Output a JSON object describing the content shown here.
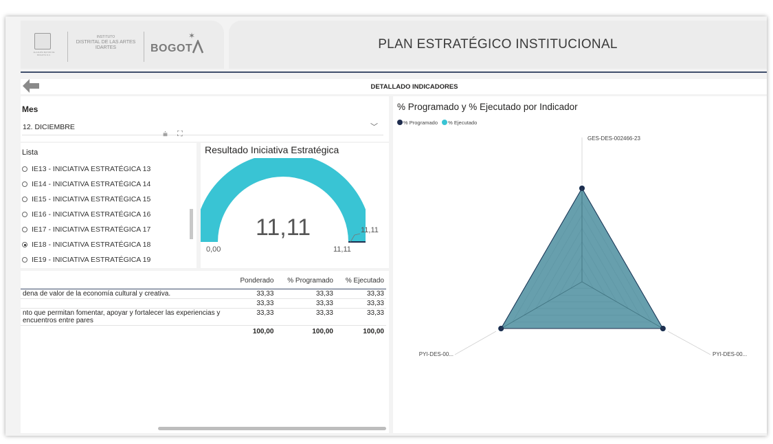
{
  "header": {
    "logo": {
      "institute_small": "INSTITUTO",
      "institute_line1": "DISTRITAL DE LAS ARTES",
      "institute_line2": "IDARTES",
      "city": "BOGOT",
      "crest_caption": "ALCALDÍA MAYOR DE BOGOTÁ D.C."
    },
    "title": "PLAN ESTRATÉGICO INSTITUCIONAL"
  },
  "subheader": {
    "title": "DETALLADO INDICADORES",
    "back_icon": "arrow-left-icon"
  },
  "filters": {
    "mes_label": "Mes",
    "mes_value": "12. DICIEMBRE",
    "lista_label": "Lista",
    "lista_items": [
      {
        "label": "IE13 - INICIATIVA ESTRATÉGICA 13",
        "selected": false
      },
      {
        "label": "IE14 - INICIATIVA ESTRATÉGICA 14",
        "selected": false
      },
      {
        "label": "IE15 - INICIATIVA ESTRATÉGICA 15",
        "selected": false
      },
      {
        "label": "IE16 - INICIATIVA ESTRATÉGICA 16",
        "selected": false
      },
      {
        "label": "IE17 - INICIATIVA ESTRATÉGICA 17",
        "selected": false
      },
      {
        "label": "IE18 - INICIATIVA ESTRATÉGICA 18",
        "selected": true
      },
      {
        "label": "IE19 - INICIATIVA ESTRATÉGICA 19",
        "selected": false
      }
    ]
  },
  "gauge": {
    "title": "Resultado Iniciativa Estratégica",
    "value": "11,11",
    "min": "0,00",
    "max": "11,11",
    "target": "11,11",
    "fill_fraction": 1.0,
    "color": "#39C4D4"
  },
  "table": {
    "columns": [
      "Ponderado",
      "% Programado",
      "% Ejecutado"
    ],
    "rows": [
      {
        "desc": "dena de valor de la economía cultural y creativa.",
        "ponderado": "33,33",
        "programado": "33,33",
        "ejecutado": "33,33"
      },
      {
        "desc": "",
        "ponderado": "33,33",
        "programado": "33,33",
        "ejecutado": "33,33"
      },
      {
        "desc": "nto que permitan fomentar, apoyar y fortalecer las experiencias y encuentros entre pares",
        "ponderado": "33,33",
        "programado": "33,33",
        "ejecutado": "33,33"
      }
    ],
    "total": {
      "ponderado": "100,00",
      "programado": "100,00",
      "ejecutado": "100,00"
    }
  },
  "radar": {
    "title": "% Programado y % Ejecutado por Indicador",
    "legend": [
      {
        "name": "% Programado",
        "color": "#1F2D4E"
      },
      {
        "name": "% Ejecutado",
        "color": "#39C4D4"
      }
    ]
  },
  "chart_data": {
    "type": "radar",
    "title": "% Programado y % Ejecutado por Indicador",
    "categories": [
      "GES-DES-002466-23",
      "PYI-DES-00...",
      "PYI-DES-00..."
    ],
    "series": [
      {
        "name": "% Programado",
        "values": [
          100,
          100,
          100
        ],
        "color": "#1F2D4E"
      },
      {
        "name": "% Ejecutado",
        "values": [
          100,
          100,
          100
        ],
        "color": "#39C4D4"
      }
    ],
    "legend_position": "top-left"
  }
}
